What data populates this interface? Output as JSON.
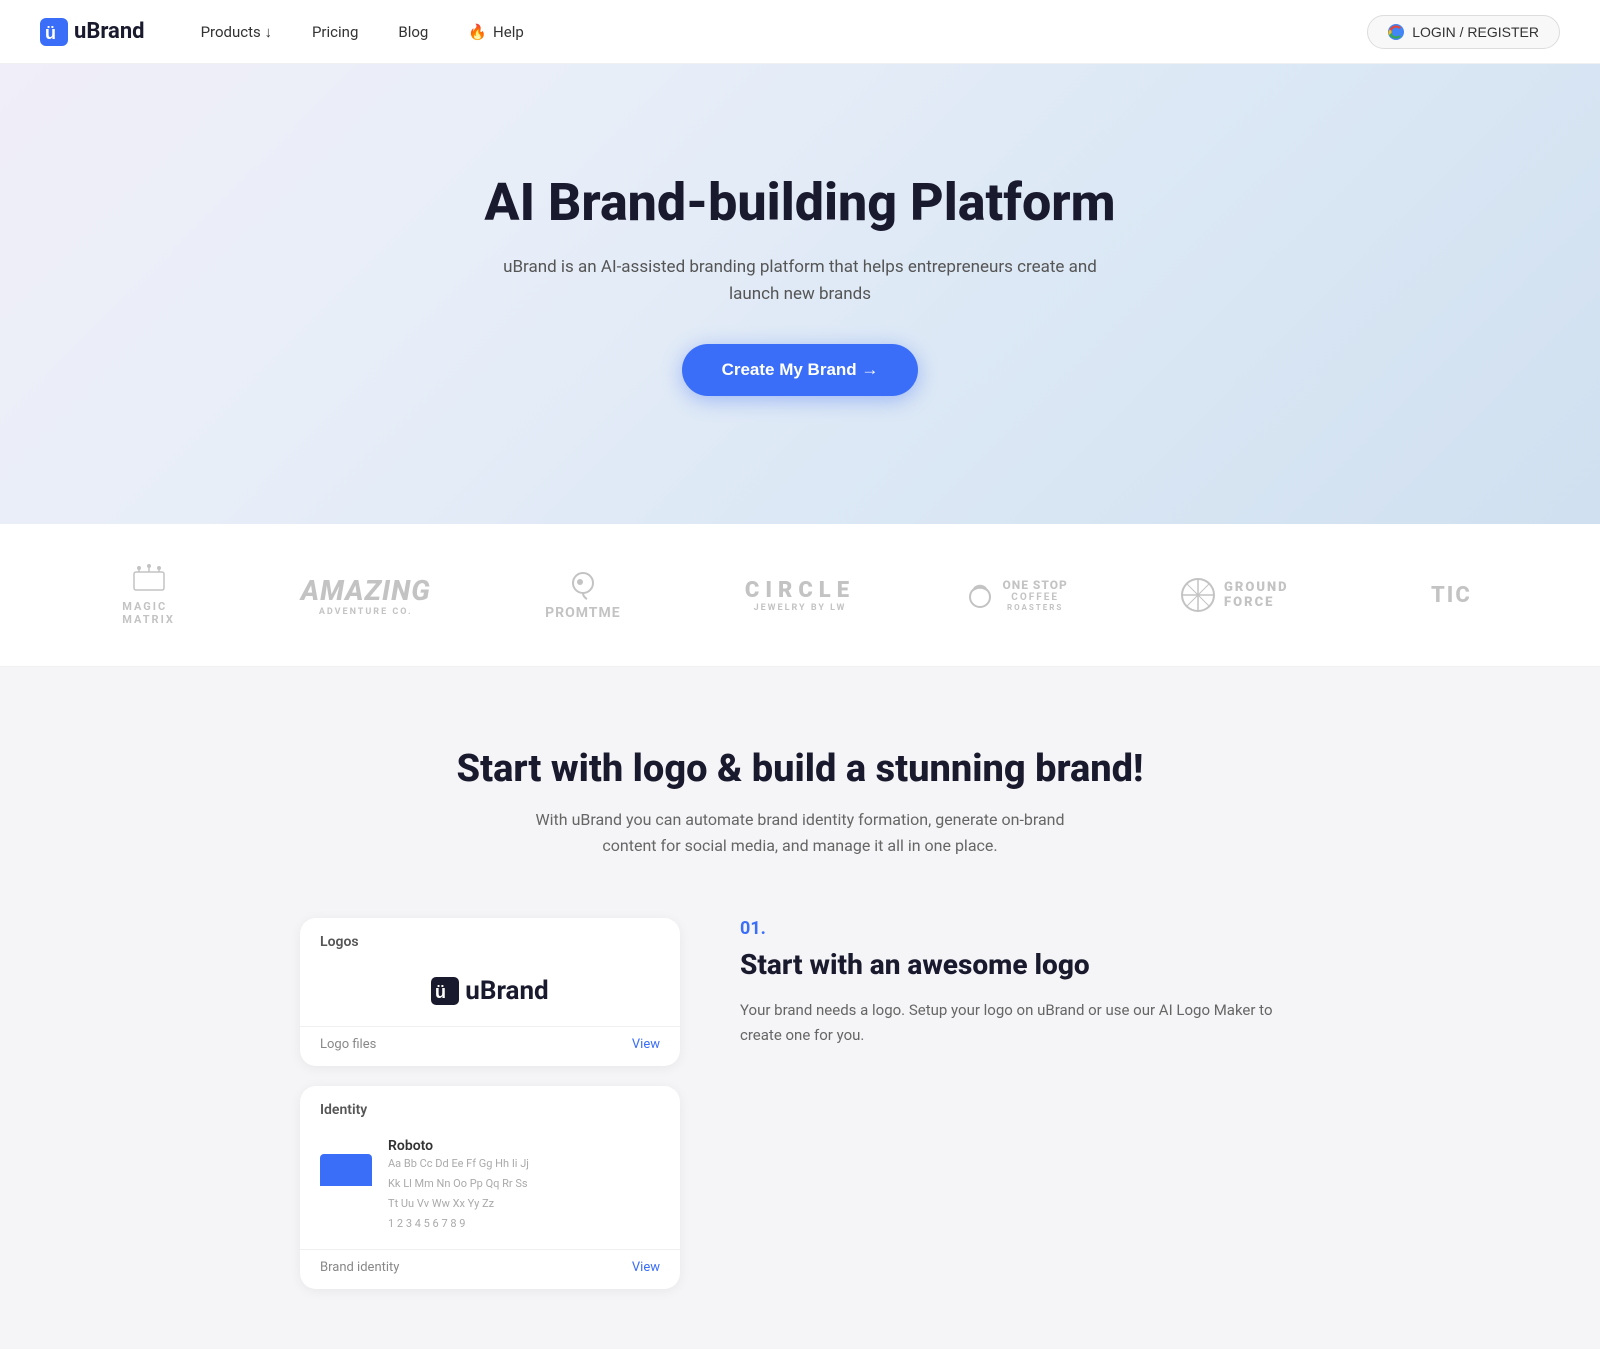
{
  "brand": {
    "logo_text": "uBrand",
    "logo_icon": "u"
  },
  "navbar": {
    "products_label": "Products ↓",
    "pricing_label": "Pricing",
    "blog_label": "Blog",
    "help_label": "Help",
    "login_label": "LOGIN / REGISTER"
  },
  "hero": {
    "title": "AI Brand-building Platform",
    "subtitle": "uBrand is an AI-assisted branding platform that helps entrepreneurs create and launch new brands",
    "cta_label": "Create My Brand →"
  },
  "logos_strip": {
    "brands": [
      {
        "name": "Magic Matrix",
        "style": "icon-text",
        "icon": "🌟"
      },
      {
        "name": "Amazing",
        "style": "italic",
        "sub": "ADVENTURE CO."
      },
      {
        "name": "PromtMe",
        "style": "icon-text-sm"
      },
      {
        "name": "CIRCLE",
        "style": "spaced",
        "sub": "JEWELRY BY LW"
      },
      {
        "name": "ONE STOP COFFEE",
        "style": "stacked",
        "sub": "ROASTERS"
      },
      {
        "name": "GROUND FORCE",
        "style": "bold-right"
      },
      {
        "name": "Tic",
        "style": "partial"
      }
    ]
  },
  "features": {
    "title": "Start with logo & build a stunning brand!",
    "subtitle": "With uBrand you can automate brand identity formation, generate on-brand content for social media, and manage it all in one place.",
    "cards": [
      {
        "id": "logos",
        "label": "Logos",
        "footer_label": "Logo files",
        "view_link": "View",
        "logo_text": "uBrand"
      },
      {
        "id": "identity",
        "label": "Identity",
        "footer_label": "Brand identity",
        "view_link": "View",
        "font_name": "Roboto",
        "font_detail": "Aa Bb Cc Dd Ee Ff Gg Hh Ii Jj\nKk Ll Mm Nn Oo Pp Qq Rr Ss\nTt Uu Vv Ww Xx Yy Zz\n1 2 3 4 5 6 7 8 9"
      }
    ],
    "feature_step": {
      "number": "01.",
      "heading": "Start with an awesome logo",
      "description": "Your brand needs a logo. Setup your logo on uBrand or use our AI Logo Maker to create one for you."
    }
  }
}
